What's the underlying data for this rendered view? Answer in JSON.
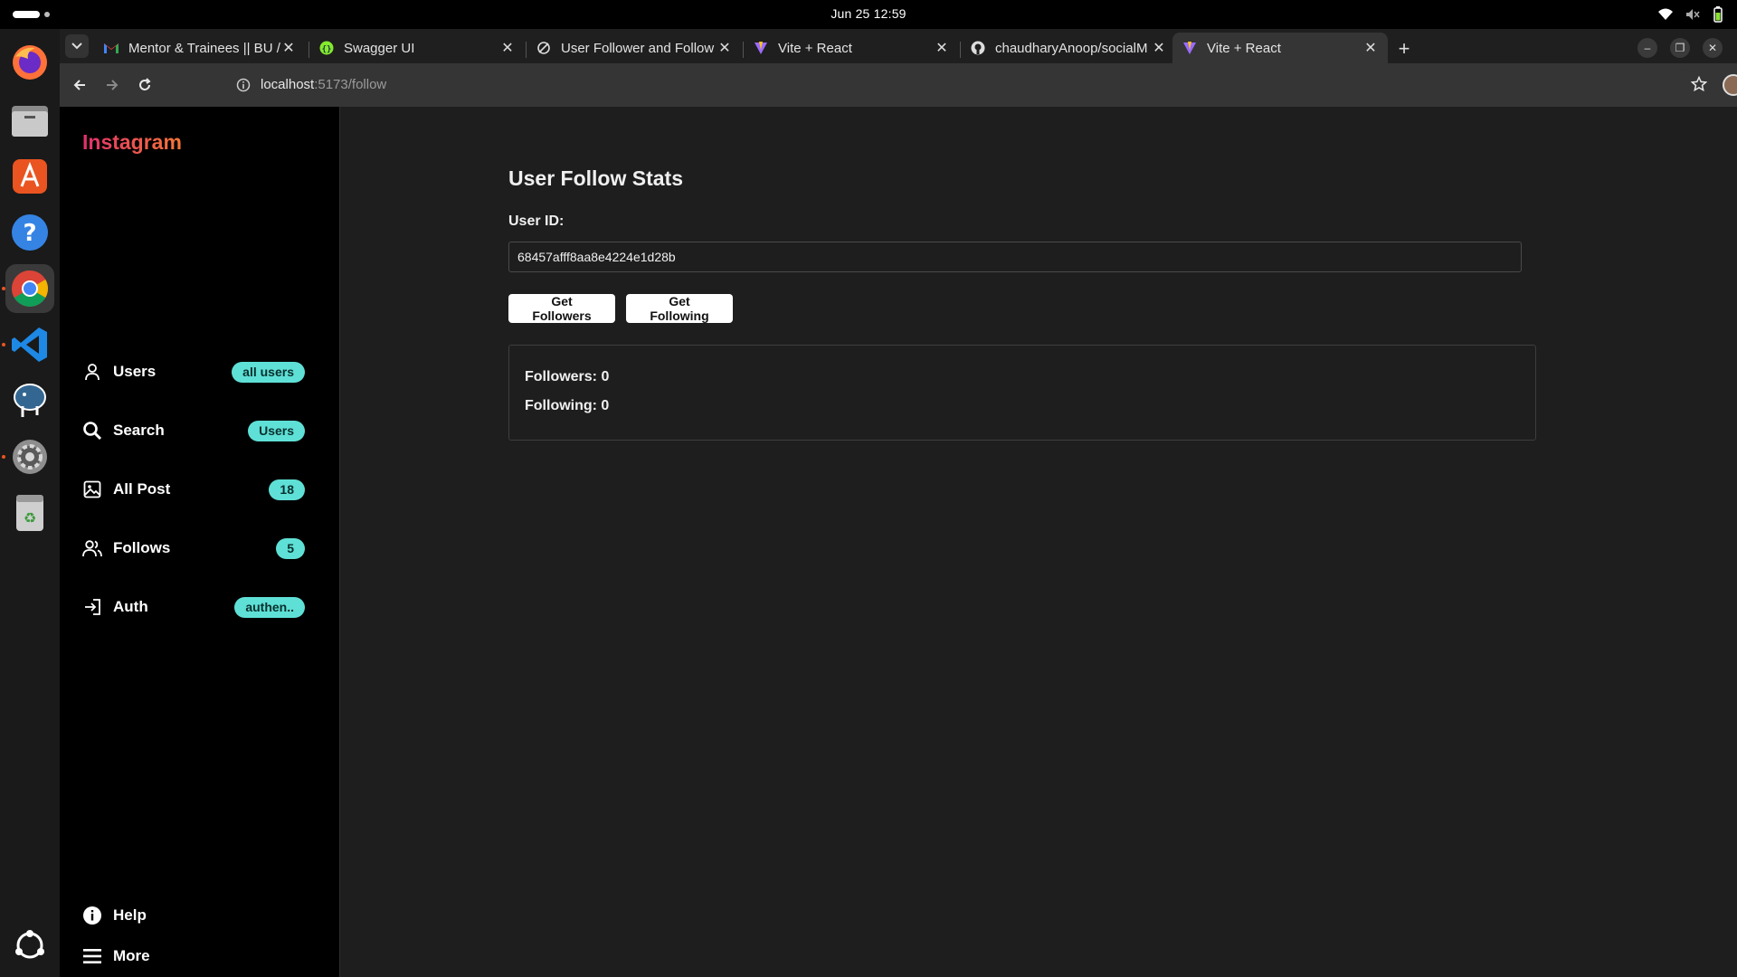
{
  "system": {
    "clock": "Jun 25  12:59"
  },
  "browser": {
    "tabs": [
      {
        "title": "Mentor & Trainees || BU /",
        "icon": "gmail-icon"
      },
      {
        "title": "Swagger UI",
        "icon": "swagger-icon"
      },
      {
        "title": "User Follower and Follow",
        "icon": "loading-icon"
      },
      {
        "title": "Vite + React",
        "icon": "vite-icon"
      },
      {
        "title": "chaudharyAnoop/socialM",
        "icon": "github-icon"
      },
      {
        "title": "Vite + React",
        "icon": "vite-icon",
        "active": true
      }
    ],
    "url_host": "localhost",
    "url_path": ":5173/follow"
  },
  "sidebar": {
    "logo": "Instagram",
    "items": [
      {
        "label": "Users",
        "badge": "all users",
        "icon": "user-icon"
      },
      {
        "label": "Search",
        "badge": "Users",
        "icon": "search-icon"
      },
      {
        "label": "All Post",
        "badge": "18",
        "icon": "image-icon"
      },
      {
        "label": "Follows",
        "badge": "5",
        "icon": "users-icon"
      },
      {
        "label": "Auth",
        "badge": "authen..",
        "icon": "login-icon"
      }
    ],
    "help_label": "Help",
    "more_label": "More"
  },
  "main": {
    "title": "User Follow Stats",
    "user_id_label": "User ID:",
    "user_id_value": "68457afff8aa8e4224e1d28b",
    "get_followers_label": "Get Followers",
    "get_following_label": "Get Following",
    "followers_text": "Followers: 0",
    "following_text": "Following: 0"
  },
  "colors": {
    "badge": "#5fe0d6",
    "logo_gradient_start": "#e1306c",
    "logo_gradient_end": "#f77737",
    "sidebar_bg": "#000000",
    "page_bg": "#1e1e1e"
  }
}
